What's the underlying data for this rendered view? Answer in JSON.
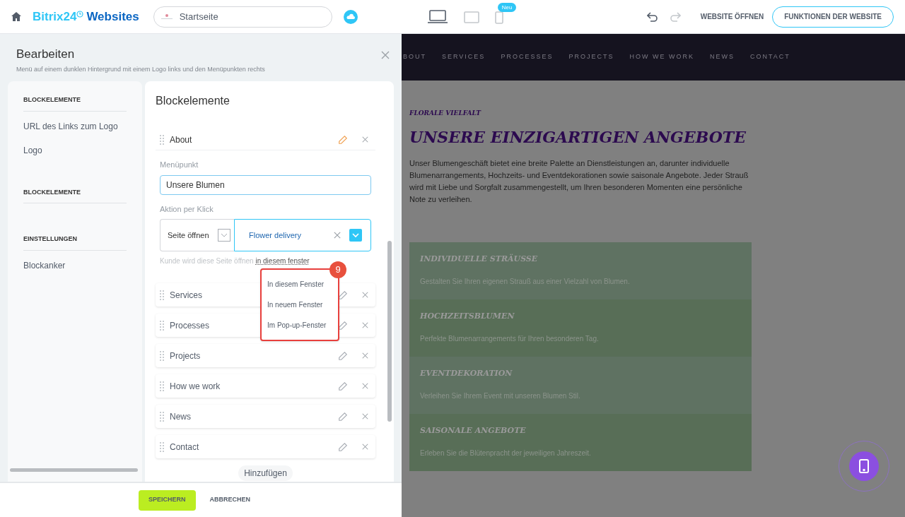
{
  "topbar": {
    "brand_first": "Bitrix24",
    "brand_second": "Websites",
    "page_field": "Startseite",
    "devices": [
      {
        "kind": "desktop",
        "selected": true
      },
      {
        "kind": "tablet",
        "selected": false
      },
      {
        "kind": "mobile",
        "selected": false,
        "badge": "Neu"
      }
    ],
    "redo_disabled": true,
    "open_link": "WEBSITE ÖFFNEN",
    "features_button": "FUNKTIONEN DER WEBSITE"
  },
  "editor": {
    "title": "Bearbeiten",
    "subtitle": "Menü auf einem dunklen Hintergrund mit einem Logo links und den Menüpunkten rechts",
    "sidebar": [
      {
        "heading": "BLOCKELEMENTE",
        "items": [
          "URL des Links zum Logo",
          "Logo"
        ]
      },
      {
        "heading": "BLOCKELEMENTE"
      },
      {
        "heading": "EINSTELLUNGEN",
        "items": [
          "Blockanker"
        ]
      }
    ],
    "panel_title": "Blockelemente",
    "items": [
      {
        "label": "About",
        "expanded": true
      },
      {
        "label": "Services",
        "expanded": false
      },
      {
        "label": "Processes",
        "expanded": false
      },
      {
        "label": "Projects",
        "expanded": false
      },
      {
        "label": "How we work",
        "expanded": false
      },
      {
        "label": "News",
        "expanded": false
      },
      {
        "label": "Contact",
        "expanded": false
      }
    ],
    "detail": {
      "name_label": "Menüpunkt",
      "name_value": "Unsere Blumen",
      "action_label": "Aktion per Klick",
      "action_type": "Seite öffnen",
      "action_target": "Flower delivery",
      "hint": "Kunde wird diese Seite öffnen",
      "hint_link": "in diesem fenster"
    },
    "dropdown": {
      "badge": "9",
      "options": [
        "In diesem Fenster",
        "In neuem Fenster",
        "Im Pop-up-Fenster"
      ]
    },
    "add_button": "Hinzufügen",
    "save_button": "SPEICHERN",
    "cancel_button": "ABBRECHEN"
  },
  "preview": {
    "nav": [
      "BOUT",
      "SERVICES",
      "PROCESSES",
      "PROJECTS",
      "HOW WE WORK",
      "NEWS",
      "CONTACT"
    ],
    "eyebrow": "FLORALE VIELFALT",
    "heading": "UNSERE EINZIGARTIGEN ANGEBOTE",
    "paragraph": "Unser Blumengeschäft bietet eine breite Palette an Dienstleistungen an, darunter individuelle Blumenarrangements, Hochzeits- und Eventdekorationen sowie saisonale Angebote. Jeder Strauß wird mit Liebe und Sorgfalt zusammengestellt, um Ihren besonderen Momenten eine persönliche Note zu verleihen.",
    "cards": [
      {
        "title": "INDIVIDUELLE STRÄUSSE",
        "text": "Gestalten Sie Ihren eigenen Strauß aus einer Vielzahl von Blumen."
      },
      {
        "title": "HOCHZEITSBLUMEN",
        "text": "Perfekte Blumenarrangements für Ihren besonderen Tag."
      },
      {
        "title": "EVENTDEKORATION",
        "text": "Verleihen Sie Ihrem Event mit unseren Blumen Stil."
      },
      {
        "title": "SAISONALE ANGEBOTE",
        "text": "Erleben Sie die Blütenpracht der jeweiligen Jahreszeit."
      }
    ]
  }
}
